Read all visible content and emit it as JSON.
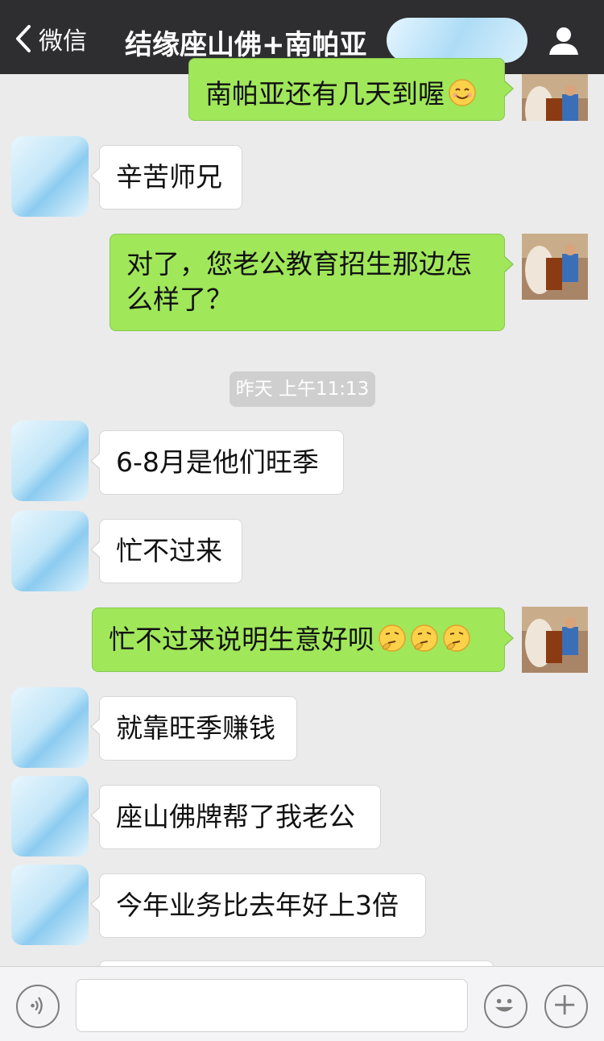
{
  "header": {
    "back_label": "微信",
    "title": "结缘座山佛+南帕亚"
  },
  "messages": [
    {
      "side": "out",
      "text": "南帕亚还有几天到喔",
      "emoji": "smile-blush"
    },
    {
      "side": "in",
      "text": "辛苦师兄"
    },
    {
      "side": "out",
      "line1": "对了，您老公教育招生那边怎",
      "line2": "么样了？"
    },
    {
      "side": "in",
      "text": "6-8月是他们旺季"
    },
    {
      "side": "in",
      "text": "忙不过来"
    },
    {
      "side": "out",
      "text": "忙不过来说明生意好呗",
      "emoji": "thinking x3"
    },
    {
      "side": "in",
      "text": "就靠旺季赚钱"
    },
    {
      "side": "in",
      "text": "座山佛牌帮了我老公"
    },
    {
      "side": "in",
      "text": "今年业务比去年好上3倍"
    }
  ],
  "timestamp": "昨天 上午11:13",
  "input_bar": {
    "voice_icon": "voice-icon",
    "emoji_icon": "emoji-icon",
    "plus_icon": "plus-icon"
  },
  "colors": {
    "header_bg": "#2e2e30",
    "chat_bg": "#ebebeb",
    "out_bubble": "#a0e75a",
    "in_bubble": "#ffffff"
  }
}
